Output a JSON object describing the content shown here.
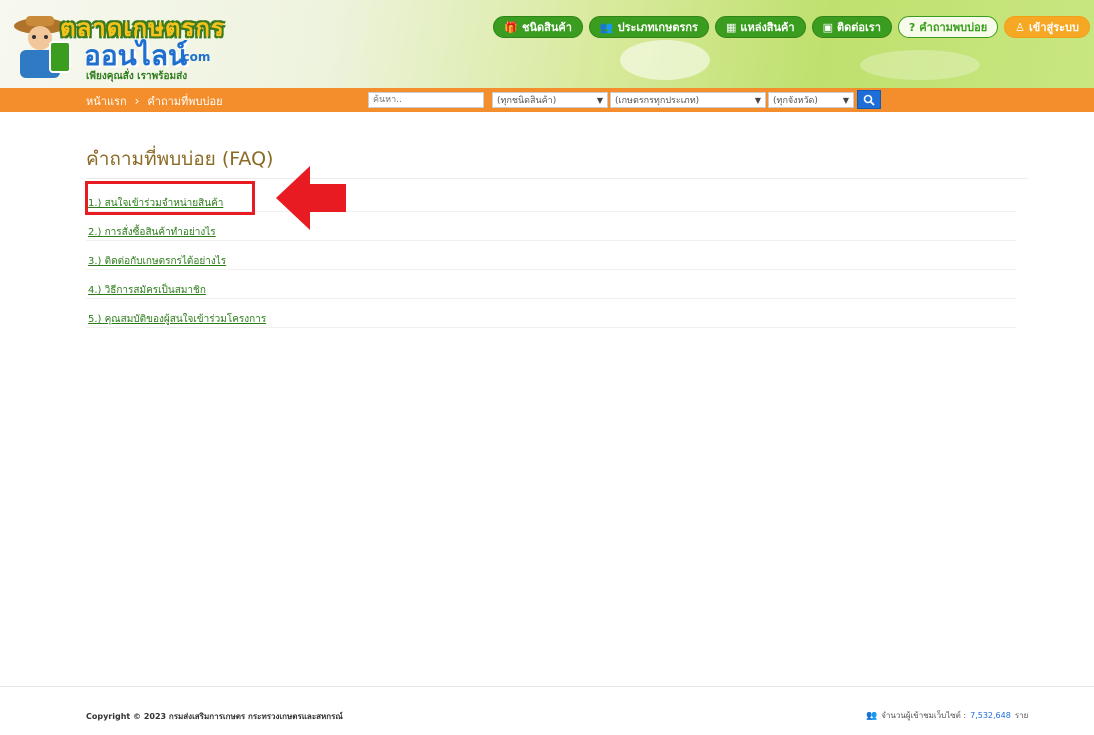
{
  "header": {
    "logo": {
      "title_top": "ตลาดเกษตรกร",
      "title_mid": "ออนไลน์",
      "title_suffix": ".com",
      "slogan": "เพียงคุณสั่ง เราพร้อมส่ง"
    },
    "nav": [
      {
        "label": "ชนิดสินค้า",
        "icon": "gift-icon"
      },
      {
        "label": "ประเภทเกษตรกร",
        "icon": "users-icon"
      },
      {
        "label": "แหล่งสินค้า",
        "icon": "map-icon"
      },
      {
        "label": "ติดต่อเรา",
        "icon": "contact-card-icon"
      },
      {
        "label": "คำถามพบบ่อย",
        "icon": "question-circle-icon"
      },
      {
        "label": "เข้าสู่ระบบ",
        "icon": "user-icon"
      }
    ],
    "colors": {
      "green": "#3a9d1f",
      "orange": "#f48e2c",
      "login": "#f6a723"
    }
  },
  "breadcrumb": {
    "home": "หน้าแรก",
    "separator": "›",
    "current": "คำถามที่พบบ่อย"
  },
  "search": {
    "placeholder": "ค้นหา..",
    "product_type": "(ทุกชนิดสินค้า)",
    "farmer_type": "(เกษตรกรทุกประเภท)",
    "province": "(ทุกจังหวัด)"
  },
  "main": {
    "title": "คำถามที่พบบ่อย (FAQ)",
    "faq": [
      "1.) สนใจเข้าร่วมจำหน่ายสินค้า",
      "2.) การสั่งซื้อสินค้าทำอย่างไร",
      "3.) ติดต่อกับเกษตรกรได้อย่างไร",
      "4.) วิธีการสมัครเป็นสมาชิก",
      "5.) คุณสมบัติของผู้สนใจเข้าร่วมโครงการ"
    ]
  },
  "footer": {
    "copyright": "Copyright © 2023 กรมส่งเสริมการเกษตร กระทรวงเกษตรและสหกรณ์",
    "visitors_label": "จำนวนผู้เข้าชมเว็บไซต์ :",
    "visitors_count": "7,532,648",
    "visitors_unit": "ราย"
  }
}
